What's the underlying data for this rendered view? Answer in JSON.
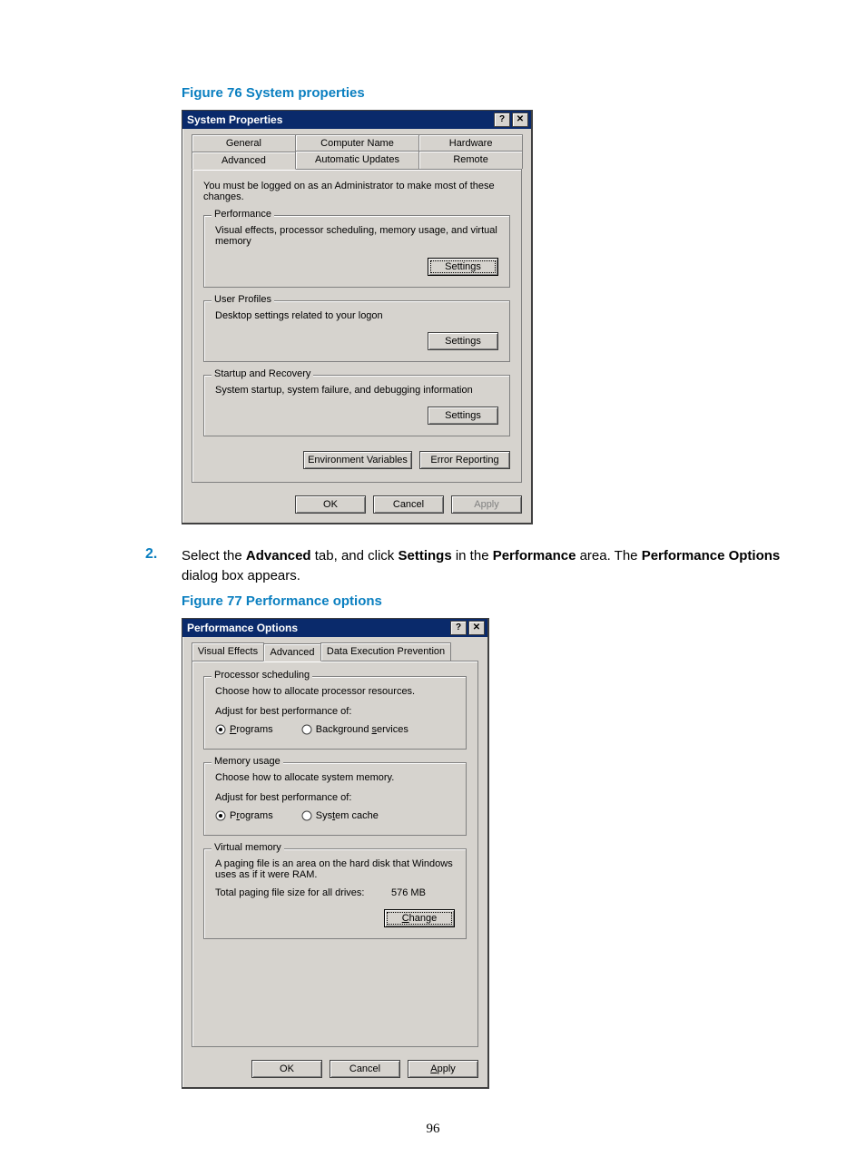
{
  "figure76_caption": "Figure 76 System properties",
  "figure77_caption": "Figure 77 Performance options",
  "step": {
    "num": "2.",
    "text_pre": "Select the ",
    "b1": "Advanced",
    "t1": " tab, and click ",
    "b2": "Settings",
    "t2": " in the ",
    "b3": "Performance",
    "t3": " area. The ",
    "b4": "Performance Options",
    "t4": " dialog box appears."
  },
  "page_number": "96",
  "sysprops": {
    "title": "System Properties",
    "tabs_row1": [
      "General",
      "Computer Name",
      "Hardware"
    ],
    "tabs_row2": [
      "Advanced",
      "Automatic Updates",
      "Remote"
    ],
    "intro": "You must be logged on as an Administrator to make most of these changes.",
    "perf": {
      "legend": "Performance",
      "desc": "Visual effects, processor scheduling, memory usage, and virtual memory",
      "btn": "Settings"
    },
    "profiles": {
      "legend": "User Profiles",
      "desc": "Desktop settings related to your logon",
      "btn": "Settings"
    },
    "startup": {
      "legend": "Startup and Recovery",
      "desc": "System startup, system failure, and debugging information",
      "btn": "Settings"
    },
    "env_btn": "Environment Variables",
    "err_btn": "Error Reporting",
    "ok": "OK",
    "cancel": "Cancel",
    "apply": "Apply"
  },
  "perfopts": {
    "title": "Performance Options",
    "tabs": [
      "Visual Effects",
      "Advanced",
      "Data Execution Prevention"
    ],
    "proc": {
      "legend": "Processor scheduling",
      "desc": "Choose how to allocate processor resources.",
      "adjust": "Adjust for best performance of:",
      "programs": "Programs",
      "bg": "Background services"
    },
    "mem": {
      "legend": "Memory usage",
      "desc": "Choose how to allocate system memory.",
      "adjust": "Adjust for best performance of:",
      "programs": "Programs",
      "cache": "System cache"
    },
    "vm": {
      "legend": "Virtual memory",
      "desc": "A paging file is an area on the hard disk that Windows uses as if it were RAM.",
      "total_label": "Total paging file size for all drives:",
      "total_value": "576 MB",
      "change": "Change"
    },
    "ok": "OK",
    "cancel": "Cancel",
    "apply": "Apply"
  }
}
